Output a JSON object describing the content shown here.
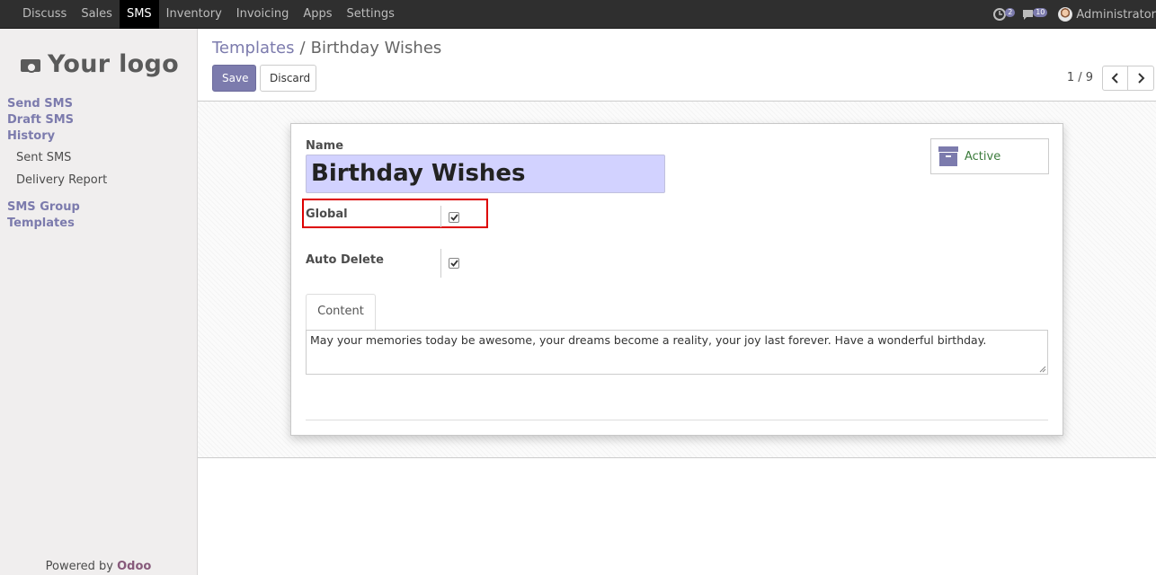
{
  "topnav": {
    "items": [
      {
        "label": "Discuss",
        "active": false
      },
      {
        "label": "Sales",
        "active": false
      },
      {
        "label": "SMS",
        "active": true
      },
      {
        "label": "Inventory",
        "active": false
      },
      {
        "label": "Invoicing",
        "active": false
      },
      {
        "label": "Apps",
        "active": false
      },
      {
        "label": "Settings",
        "active": false
      }
    ],
    "activity_count": "2",
    "messages_count": "10",
    "user_name": "Administrator"
  },
  "sidebar": {
    "logo_text": "Your logo",
    "menu": {
      "send_sms": "Send SMS",
      "draft_sms": "Draft SMS",
      "history": "History",
      "sent_sms": "Sent SMS",
      "delivery_report": "Delivery Report",
      "sms_group": "SMS Group",
      "templates": "Templates"
    },
    "powered_by": "Powered by",
    "powered_brand": "Odoo"
  },
  "control_panel": {
    "breadcrumb_parent": "Templates",
    "breadcrumb_separator": "/",
    "breadcrumb_current": "Birthday Wishes",
    "save_label": "Save",
    "discard_label": "Discard",
    "pager_value": "1 / 9"
  },
  "form": {
    "name_label": "Name",
    "name_value": "Birthday Wishes",
    "active_label": "Active",
    "global_label": "Global",
    "global_checked": true,
    "auto_delete_label": "Auto Delete",
    "auto_delete_checked": true,
    "tab_content": "Content",
    "content_value": "May your memories today be awesome, your dreams become a reality, your joy last forever. Have a wonderful birthday."
  },
  "colors": {
    "brand": "#7c7bad",
    "topbar": "#2f2f2f",
    "active_status": "#3c7c3c",
    "name_field_bg": "#d2d2ff",
    "highlight": "#dd0000"
  }
}
